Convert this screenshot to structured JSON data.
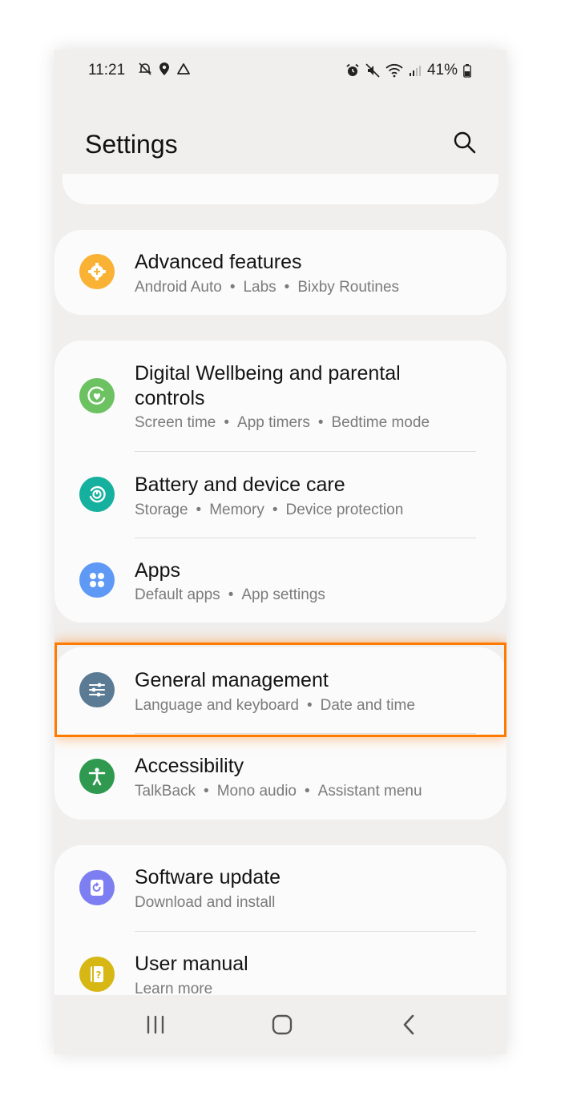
{
  "status_bar": {
    "time": "11:21",
    "battery": "41%",
    "left_icons": [
      "mute-notification-icon",
      "location-icon",
      "drive-icon"
    ],
    "right_icons": [
      "alarm-icon",
      "vibrate-mute-icon",
      "wifi-icon",
      "signal-icon",
      "battery-icon"
    ]
  },
  "header": {
    "title": "Settings",
    "search_icon": "search-icon"
  },
  "colors": {
    "highlight": "#ff7a00"
  },
  "groups": [
    {
      "items": [
        {
          "title": "Advanced features",
          "subs": [
            "Android Auto",
            "Labs",
            "Bixby Routines"
          ],
          "icon": "gear-plus-icon",
          "color": "#f9b234"
        }
      ]
    },
    {
      "items": [
        {
          "title": "Digital Wellbeing and parental controls",
          "title_lines": [
            "Digital Wellbeing and parental",
            "controls"
          ],
          "subs": [
            "Screen time",
            "App timers",
            "Bedtime mode"
          ],
          "icon": "wellbeing-icon",
          "color": "#6cc261"
        },
        {
          "title": "Battery and device care",
          "subs": [
            "Storage",
            "Memory",
            "Device protection"
          ],
          "icon": "device-care-icon",
          "color": "#15b09e"
        },
        {
          "title": "Apps",
          "subs": [
            "Default apps",
            "App settings"
          ],
          "icon": "apps-icon",
          "color": "#5e9af5"
        }
      ]
    },
    {
      "items": [
        {
          "title": "General management",
          "subs": [
            "Language and keyboard",
            "Date and time"
          ],
          "icon": "sliders-icon",
          "color": "#5b7a93"
        },
        {
          "title": "Accessibility",
          "subs": [
            "TalkBack",
            "Mono audio",
            "Assistant menu"
          ],
          "icon": "accessibility-icon",
          "color": "#2f9a4f"
        }
      ]
    },
    {
      "items": [
        {
          "title": "Software update",
          "subs": [
            "Download and install"
          ],
          "icon": "software-update-icon",
          "color": "#7d7ef2"
        },
        {
          "title": "User manual",
          "subs": [
            "Learn more"
          ],
          "icon": "user-manual-icon",
          "color": "#d6b714"
        }
      ]
    }
  ],
  "sep": "•",
  "navbar": {
    "recents": "recents-icon",
    "home": "home-icon",
    "back": "back-icon"
  }
}
